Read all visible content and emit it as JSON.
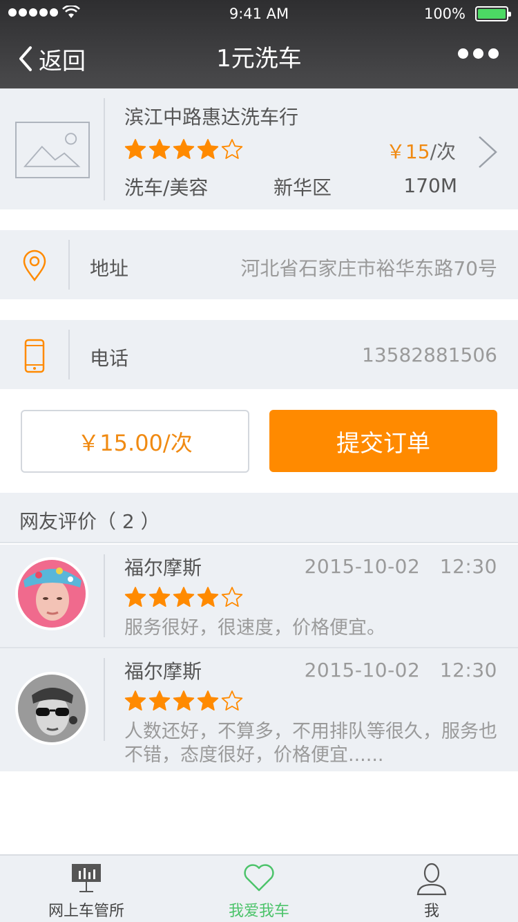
{
  "status_bar": {
    "time": "9:41 AM",
    "battery": "100%"
  },
  "nav": {
    "back_label": "返回",
    "title": "1元洗车"
  },
  "shop": {
    "name": "滨江中路惠达洗车行",
    "rating": 4,
    "rating_max": 5,
    "price": "￥15",
    "price_unit": "/次",
    "category": "洗车/美容",
    "district": "新华区",
    "distance": "170M"
  },
  "address": {
    "label": "地址",
    "value": "河北省石家庄市裕华东路70号"
  },
  "phone": {
    "label": "电话",
    "value": "13582881506"
  },
  "order": {
    "price_display": "￥15.00/次",
    "submit_label": "提交订单"
  },
  "reviews": {
    "header": "网友评价（ 2 ）",
    "items": [
      {
        "name": "福尔摩斯",
        "date": "2015-10-02　12:30",
        "rating": 4,
        "text": "服务很好，很速度，价格便宜。"
      },
      {
        "name": "福尔摩斯",
        "date": "2015-10-02　12:30",
        "rating": 4,
        "text": "人数还好，不算多，不用排队等很久，服务也不错，态度很好，价格便宜......"
      }
    ]
  },
  "tabbar": {
    "items": [
      {
        "label": "网上车管所",
        "icon": "presentation-board-icon"
      },
      {
        "label": "我爱我车",
        "icon": "heart-icon",
        "active": true
      },
      {
        "label": "我",
        "icon": "user-icon"
      }
    ]
  },
  "colors": {
    "accent": "#ff8a00",
    "active_tab": "#4cc36a",
    "star": "#ff8a00"
  }
}
